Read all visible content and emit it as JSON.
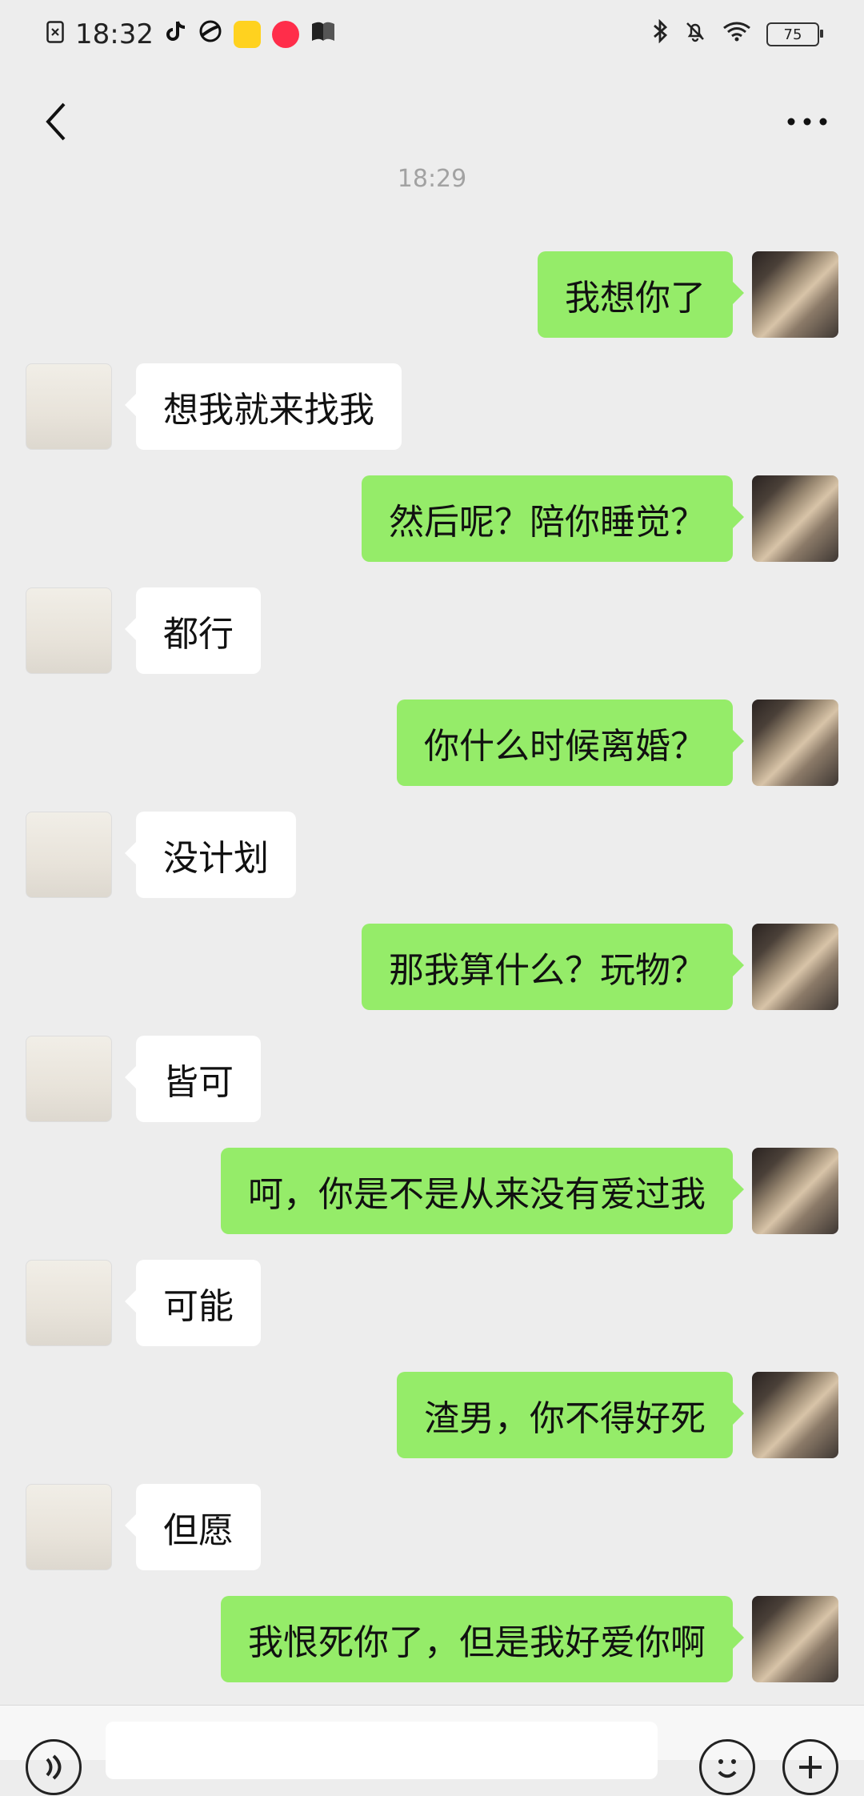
{
  "status_bar": {
    "time": "18:32",
    "battery": "75"
  },
  "chat": {
    "timestamp": "18:29",
    "messages": [
      {
        "side": "right",
        "text": "我想你了"
      },
      {
        "side": "left",
        "text": "想我就来找我"
      },
      {
        "side": "right",
        "text": "然后呢？陪你睡觉？"
      },
      {
        "side": "left",
        "text": "都行"
      },
      {
        "side": "right",
        "text": "你什么时候离婚？"
      },
      {
        "side": "left",
        "text": "没计划"
      },
      {
        "side": "right",
        "text": "那我算什么？玩物？"
      },
      {
        "side": "left",
        "text": "皆可"
      },
      {
        "side": "right",
        "text": "呵，你是不是从来没有爱过我"
      },
      {
        "side": "left",
        "text": "可能"
      },
      {
        "side": "right",
        "text": "渣男，你不得好死"
      },
      {
        "side": "left",
        "text": "但愿"
      },
      {
        "side": "right",
        "text": "我恨死你了，但是我好爱你啊"
      }
    ]
  },
  "icons": {
    "back": "chevron-left-icon",
    "more": "more-icon",
    "voice": "voice-icon",
    "emoji": "emoji-icon",
    "plus": "plus-icon"
  }
}
